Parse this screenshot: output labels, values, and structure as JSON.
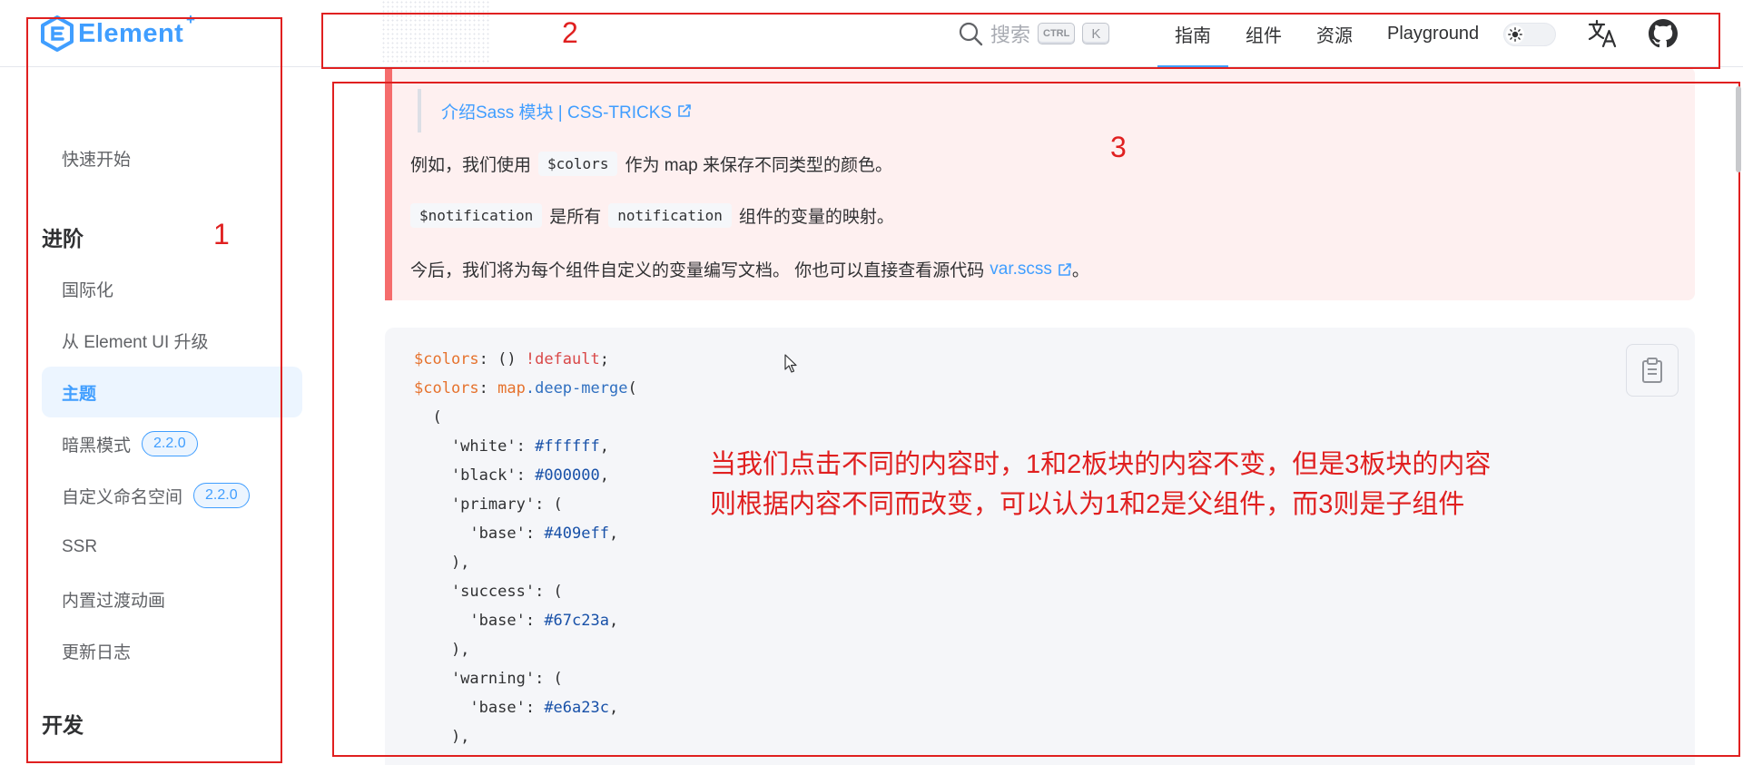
{
  "header": {
    "logo_text": "Element",
    "logo_plus": "+",
    "search": {
      "label": "搜索",
      "key_ctrl": "CTRL",
      "key_k": "K"
    },
    "nav": [
      {
        "label": "指南",
        "active": true
      },
      {
        "label": "组件",
        "active": false
      },
      {
        "label": "资源",
        "active": false
      },
      {
        "label": "Playground",
        "active": false
      }
    ],
    "icons": [
      "sun-icon",
      "translate-icon",
      "github-icon"
    ]
  },
  "sidebar": {
    "items": [
      {
        "label": "快速开始",
        "type": "item"
      },
      {
        "label": "进阶",
        "type": "group"
      },
      {
        "label": "国际化",
        "type": "item"
      },
      {
        "label": "从 Element UI 升级",
        "type": "item"
      },
      {
        "label": "主题",
        "type": "item",
        "active": true
      },
      {
        "label": "暗黑模式",
        "type": "item",
        "badge": "2.2.0"
      },
      {
        "label": "自定义命名空间",
        "type": "item",
        "badge": "2.2.0"
      },
      {
        "label": "SSR",
        "type": "item"
      },
      {
        "label": "内置过渡动画",
        "type": "item"
      },
      {
        "label": "更新日志",
        "type": "item"
      },
      {
        "label": "开发",
        "type": "group"
      }
    ]
  },
  "content": {
    "quote_link": "介绍Sass 模块 | CSS-TRICKS",
    "para1": {
      "before": "例如，我们使用",
      "code": "$colors",
      "after": "作为 map 来保存不同类型的颜色。"
    },
    "para2": {
      "code1": "$notification",
      "mid": "是所有",
      "code2": "notification",
      "after": "组件的变量的映射。"
    },
    "para3": {
      "before": "今后，我们将为每个组件自定义的变量编写文档。 你也可以直接查看源代码",
      "link": "var.scss",
      "after": "。"
    },
    "code": {
      "line1": {
        "var": "$colors",
        "rest": ": () ",
        "kw": "!default",
        "end": ";"
      },
      "line2": {
        "var": "$colors",
        "sep": ": ",
        "ns": "map",
        "fn": ".deep-merge",
        "end": "("
      },
      "line3": "  (",
      "white": {
        "key": "    'white'",
        "val": "#ffffff"
      },
      "black": {
        "key": "    'black'",
        "val": "#000000"
      },
      "primary": {
        "key": "    'primary'",
        "base": "#409eff"
      },
      "success": {
        "key": "    'success'",
        "base": "#67c23a"
      },
      "warning": {
        "key": "    'warning'",
        "base": "#e6a23c"
      },
      "base_key": "      'base'",
      "open": ": (",
      "close": "    ),"
    }
  },
  "annotations": {
    "numbers": [
      "1",
      "2",
      "3"
    ],
    "note_line1": "当我们点击不同的内容时，1和2板块的内容不变，但是3板块的内容",
    "note_line2": "则根据内容不同而改变，可以认为1和2是父组件，而3则是子组件",
    "color": "#e02020"
  },
  "colors": {
    "accent": "#409eff",
    "danger_bg": "#fef0f0",
    "danger_border": "#f56c6c"
  }
}
